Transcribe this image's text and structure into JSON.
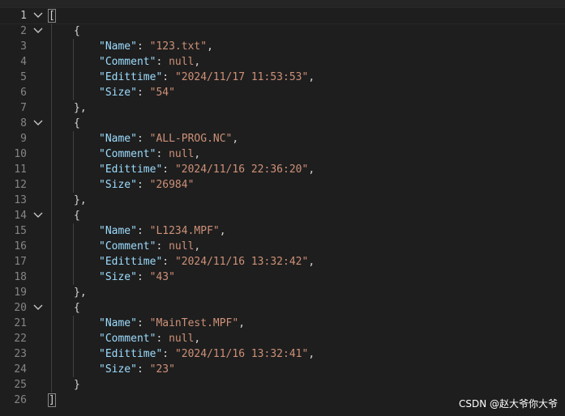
{
  "editor": {
    "lines": [
      {
        "n": "1",
        "fold": true,
        "indent": 0,
        "tokens": [
          {
            "t": "[",
            "c": "p"
          }
        ]
      },
      {
        "n": "2",
        "fold": true,
        "indent": 1,
        "tokens": [
          {
            "t": "{",
            "c": "p"
          }
        ]
      },
      {
        "n": "3",
        "fold": false,
        "indent": 2,
        "tokens": [
          {
            "t": "\"Name\"",
            "c": "key"
          },
          {
            "t": ": ",
            "c": "p"
          },
          {
            "t": "\"123.txt\"",
            "c": "str"
          },
          {
            "t": ",",
            "c": "p"
          }
        ]
      },
      {
        "n": "4",
        "fold": false,
        "indent": 2,
        "tokens": [
          {
            "t": "\"Comment\"",
            "c": "key"
          },
          {
            "t": ": ",
            "c": "p"
          },
          {
            "t": "null",
            "c": "kw2"
          },
          {
            "t": ",",
            "c": "p"
          }
        ]
      },
      {
        "n": "5",
        "fold": false,
        "indent": 2,
        "tokens": [
          {
            "t": "\"Edittime\"",
            "c": "key"
          },
          {
            "t": ": ",
            "c": "p"
          },
          {
            "t": "\"2024/11/17 11:53:53\"",
            "c": "str"
          },
          {
            "t": ",",
            "c": "p"
          }
        ]
      },
      {
        "n": "6",
        "fold": false,
        "indent": 2,
        "tokens": [
          {
            "t": "\"Size\"",
            "c": "key"
          },
          {
            "t": ": ",
            "c": "p"
          },
          {
            "t": "\"54\"",
            "c": "str"
          }
        ]
      },
      {
        "n": "7",
        "fold": false,
        "indent": 1,
        "tokens": [
          {
            "t": "},",
            "c": "p"
          }
        ]
      },
      {
        "n": "8",
        "fold": true,
        "indent": 1,
        "tokens": [
          {
            "t": "{",
            "c": "p"
          }
        ]
      },
      {
        "n": "9",
        "fold": false,
        "indent": 2,
        "tokens": [
          {
            "t": "\"Name\"",
            "c": "key"
          },
          {
            "t": ": ",
            "c": "p"
          },
          {
            "t": "\"ALL-PROG.NC\"",
            "c": "str"
          },
          {
            "t": ",",
            "c": "p"
          }
        ]
      },
      {
        "n": "10",
        "fold": false,
        "indent": 2,
        "tokens": [
          {
            "t": "\"Comment\"",
            "c": "key"
          },
          {
            "t": ": ",
            "c": "p"
          },
          {
            "t": "null",
            "c": "kw2"
          },
          {
            "t": ",",
            "c": "p"
          }
        ]
      },
      {
        "n": "11",
        "fold": false,
        "indent": 2,
        "tokens": [
          {
            "t": "\"Edittime\"",
            "c": "key"
          },
          {
            "t": ": ",
            "c": "p"
          },
          {
            "t": "\"2024/11/16 22:36:20\"",
            "c": "str"
          },
          {
            "t": ",",
            "c": "p"
          }
        ]
      },
      {
        "n": "12",
        "fold": false,
        "indent": 2,
        "tokens": [
          {
            "t": "\"Size\"",
            "c": "key"
          },
          {
            "t": ": ",
            "c": "p"
          },
          {
            "t": "\"26984\"",
            "c": "str"
          }
        ]
      },
      {
        "n": "13",
        "fold": false,
        "indent": 1,
        "tokens": [
          {
            "t": "},",
            "c": "p"
          }
        ]
      },
      {
        "n": "14",
        "fold": true,
        "indent": 1,
        "tokens": [
          {
            "t": "{",
            "c": "p"
          }
        ]
      },
      {
        "n": "15",
        "fold": false,
        "indent": 2,
        "tokens": [
          {
            "t": "\"Name\"",
            "c": "key"
          },
          {
            "t": ": ",
            "c": "p"
          },
          {
            "t": "\"L1234.MPF\"",
            "c": "str"
          },
          {
            "t": ",",
            "c": "p"
          }
        ]
      },
      {
        "n": "16",
        "fold": false,
        "indent": 2,
        "tokens": [
          {
            "t": "\"Comment\"",
            "c": "key"
          },
          {
            "t": ": ",
            "c": "p"
          },
          {
            "t": "null",
            "c": "kw2"
          },
          {
            "t": ",",
            "c": "p"
          }
        ]
      },
      {
        "n": "17",
        "fold": false,
        "indent": 2,
        "tokens": [
          {
            "t": "\"Edittime\"",
            "c": "key"
          },
          {
            "t": ": ",
            "c": "p"
          },
          {
            "t": "\"2024/11/16 13:32:42\"",
            "c": "str"
          },
          {
            "t": ",",
            "c": "p"
          }
        ]
      },
      {
        "n": "18",
        "fold": false,
        "indent": 2,
        "tokens": [
          {
            "t": "\"Size\"",
            "c": "key"
          },
          {
            "t": ": ",
            "c": "p"
          },
          {
            "t": "\"43\"",
            "c": "str"
          }
        ]
      },
      {
        "n": "19",
        "fold": false,
        "indent": 1,
        "tokens": [
          {
            "t": "},",
            "c": "p"
          }
        ]
      },
      {
        "n": "20",
        "fold": true,
        "indent": 1,
        "tokens": [
          {
            "t": "{",
            "c": "p"
          }
        ]
      },
      {
        "n": "21",
        "fold": false,
        "indent": 2,
        "tokens": [
          {
            "t": "\"Name\"",
            "c": "key"
          },
          {
            "t": ": ",
            "c": "p"
          },
          {
            "t": "\"MainTest.MPF\"",
            "c": "str"
          },
          {
            "t": ",",
            "c": "p"
          }
        ]
      },
      {
        "n": "22",
        "fold": false,
        "indent": 2,
        "tokens": [
          {
            "t": "\"Comment\"",
            "c": "key"
          },
          {
            "t": ": ",
            "c": "p"
          },
          {
            "t": "null",
            "c": "kw2"
          },
          {
            "t": ",",
            "c": "p"
          }
        ]
      },
      {
        "n": "23",
        "fold": false,
        "indent": 2,
        "tokens": [
          {
            "t": "\"Edittime\"",
            "c": "key"
          },
          {
            "t": ": ",
            "c": "p"
          },
          {
            "t": "\"2024/11/16 13:32:41\"",
            "c": "str"
          },
          {
            "t": ",",
            "c": "p"
          }
        ]
      },
      {
        "n": "24",
        "fold": false,
        "indent": 2,
        "tokens": [
          {
            "t": "\"Size\"",
            "c": "key"
          },
          {
            "t": ": ",
            "c": "p"
          },
          {
            "t": "\"23\"",
            "c": "str"
          }
        ]
      },
      {
        "n": "25",
        "fold": false,
        "indent": 1,
        "tokens": [
          {
            "t": "}",
            "c": "p"
          }
        ]
      },
      {
        "n": "26",
        "fold": false,
        "indent": 0,
        "tokens": [
          {
            "t": "]",
            "c": "p"
          }
        ]
      }
    ],
    "current_line": "1",
    "fold_icon": "chevron-down-icon"
  },
  "watermark": "CSDN @赵大爷你大爷",
  "colors": {
    "background": "#1e1e1e",
    "key": "#9cdcfe",
    "string": "#ce9178",
    "punctuation": "#d4d4d4",
    "line_number": "#858585"
  }
}
